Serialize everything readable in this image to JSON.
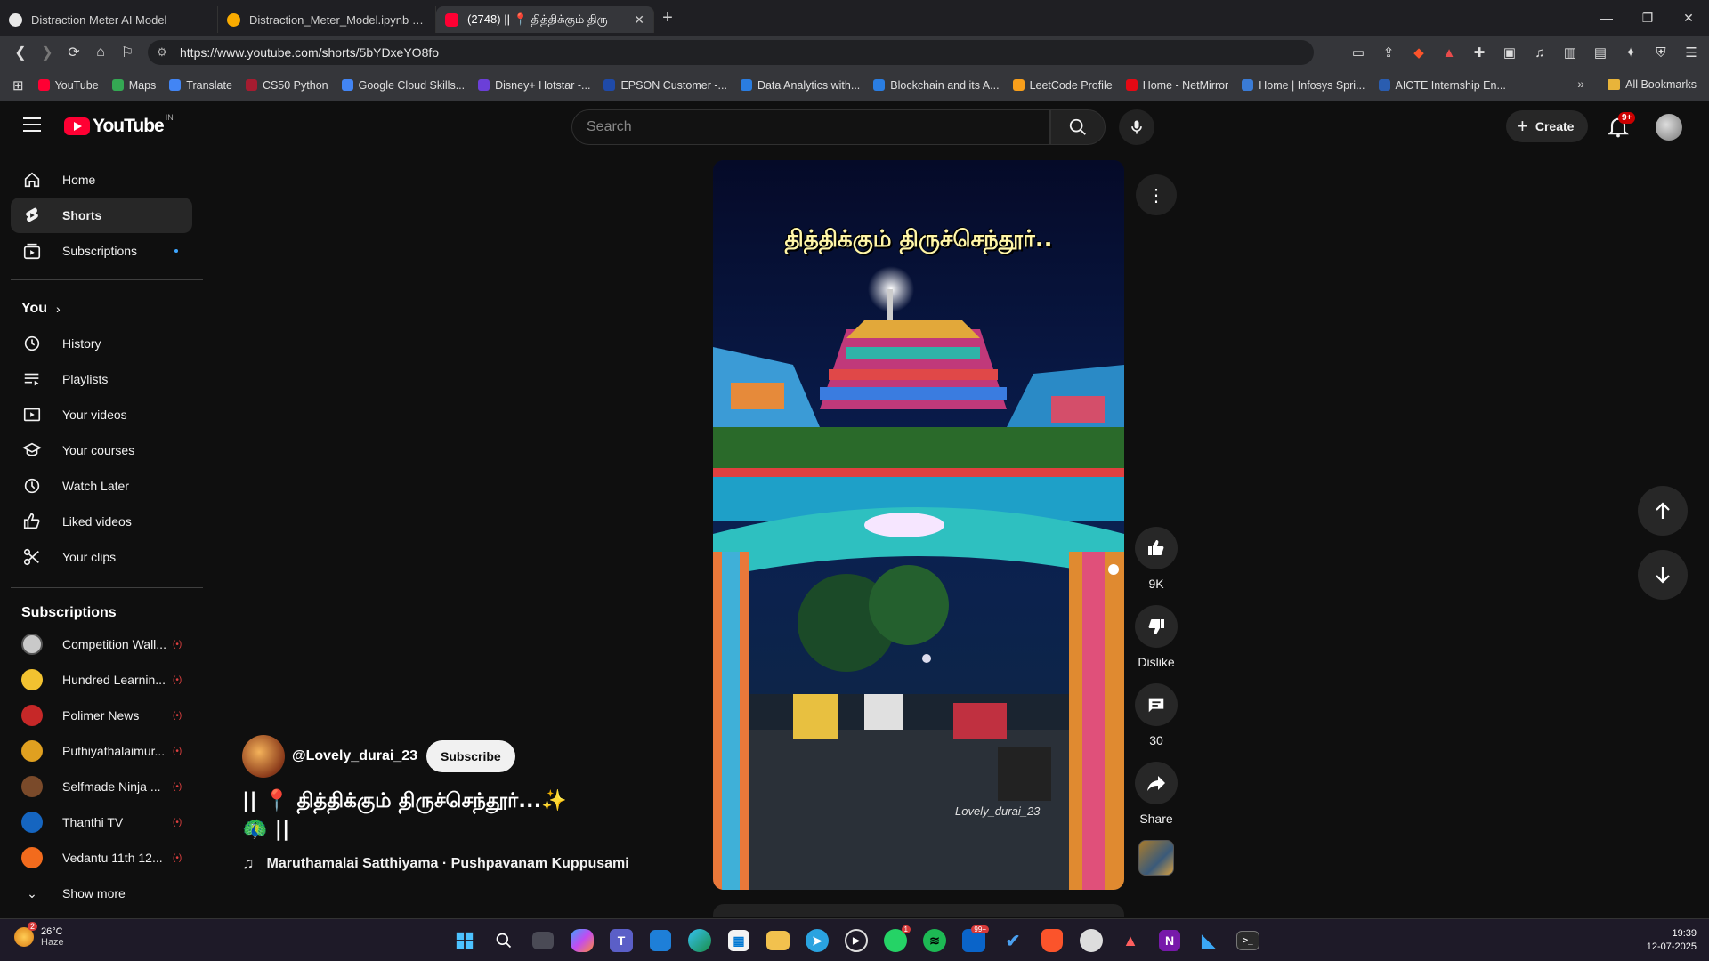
{
  "browser": {
    "tabs": [
      {
        "title": "Distraction Meter AI Model",
        "active": false,
        "favicon_color": "#e8e8e8"
      },
      {
        "title": "Distraction_Meter_Model.ipynb - Col",
        "active": false,
        "favicon_color": "#f9ab00"
      },
      {
        "title": "(2748) || 📍 தித்திக்கும் திரு",
        "active": true,
        "favicon_color": "#ff0033"
      }
    ],
    "url": "https://www.youtube.com/shorts/5bYDxeYO8fo",
    "bookmarks": [
      {
        "label": "YouTube",
        "color": "#ff0033"
      },
      {
        "label": "Maps",
        "color": "#34a853"
      },
      {
        "label": "Translate",
        "color": "#4285f4"
      },
      {
        "label": "CS50 Python",
        "color": "#a51c30"
      },
      {
        "label": "Google Cloud Skills...",
        "color": "#4285f4"
      },
      {
        "label": "Disney+ Hotstar -...",
        "color": "#6b3fd8"
      },
      {
        "label": "EPSON Customer -...",
        "color": "#1f4aa8"
      },
      {
        "label": "Data Analytics with...",
        "color": "#2a7de1"
      },
      {
        "label": "Blockchain and its A...",
        "color": "#2a7de1"
      },
      {
        "label": "LeetCode Profile",
        "color": "#f89f1b"
      },
      {
        "label": "Home - NetMirror",
        "color": "#e50914"
      },
      {
        "label": "Home | Infosys Spri...",
        "color": "#3a7bd5"
      },
      {
        "label": "AICTE Internship En...",
        "color": "#2a5db0"
      }
    ],
    "all_bookmarks": "All Bookmarks"
  },
  "yt": {
    "logo_text": "YouTube",
    "country_code": "IN",
    "search_placeholder": "Search",
    "create_label": "Create",
    "notif_badge": "9+"
  },
  "sidebar": {
    "main": [
      {
        "label": "Home",
        "icon": "home-icon"
      },
      {
        "label": "Shorts",
        "icon": "shorts-icon",
        "active": true
      },
      {
        "label": "Subscriptions",
        "icon": "subscriptions-icon"
      }
    ],
    "you_title": "You",
    "you_items": [
      {
        "label": "History",
        "icon": "history-icon"
      },
      {
        "label": "Playlists",
        "icon": "playlists-icon"
      },
      {
        "label": "Your videos",
        "icon": "your-videos-icon"
      },
      {
        "label": "Your courses",
        "icon": "courses-icon"
      },
      {
        "label": "Watch Later",
        "icon": "watch-later-icon"
      },
      {
        "label": "Liked videos",
        "icon": "liked-icon"
      },
      {
        "label": "Your clips",
        "icon": "clips-icon"
      }
    ],
    "subs_title": "Subscriptions",
    "subscriptions": [
      {
        "label": "Competition Wall...",
        "color": "#c9c9c9"
      },
      {
        "label": "Hundred Learnin...",
        "color": "#f2c230"
      },
      {
        "label": "Polimer News",
        "color": "#c62828"
      },
      {
        "label": "Puthiyathalaimur...",
        "color": "#e0a020"
      },
      {
        "label": "Selfmade Ninja ...",
        "color": "#7a4a2a"
      },
      {
        "label": "Thanthi TV",
        "color": "#1565c0"
      },
      {
        "label": "Vedantu 11th 12...",
        "color": "#f26b1d"
      }
    ],
    "show_more": "Show more"
  },
  "short": {
    "caption": "தித்திக்கும் திருச்செந்தூர்..",
    "watermark": "Lovely_durai_23",
    "like_count": "9K",
    "dislike_label": "Dislike",
    "comment_count": "30",
    "share_label": "Share",
    "channel": "@Lovely_durai_23",
    "subscribe_label": "Subscribe",
    "title_line1": "|| 📍 தித்திக்கும் திருச்செந்தூர்...✨",
    "title_line2": "🦚 ||",
    "music": "Maruthamalai Satthiyama · Pushpavanam Kuppusami"
  },
  "taskbar": {
    "temp": "26°C",
    "weather": "Haze",
    "weather_badge": "2",
    "time": "19:39",
    "date": "12-07-2025",
    "whatsapp_badge": "1",
    "mail_badge": "99+"
  }
}
